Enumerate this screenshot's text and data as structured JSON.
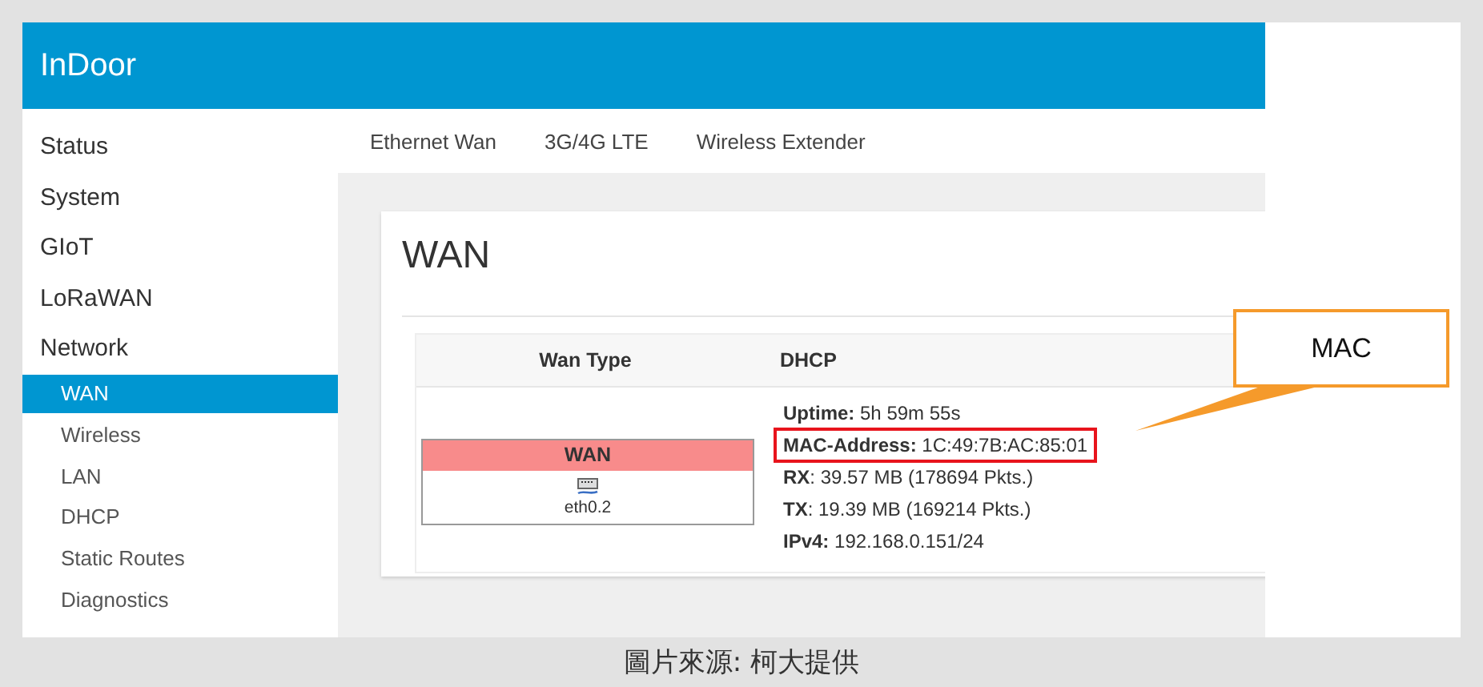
{
  "app": {
    "title": "InDoor"
  },
  "sidebar": {
    "items": [
      {
        "label": "Status",
        "selected": false
      },
      {
        "label": "System",
        "selected": false
      },
      {
        "label": "GIoT",
        "selected": false
      },
      {
        "label": "LoRaWAN",
        "selected": false
      },
      {
        "label": "Network",
        "selected": false,
        "children": [
          {
            "label": "WAN",
            "selected": true
          },
          {
            "label": "Wireless",
            "selected": false
          },
          {
            "label": "LAN",
            "selected": false
          },
          {
            "label": "DHCP",
            "selected": false
          },
          {
            "label": "Static Routes",
            "selected": false
          },
          {
            "label": "Diagnostics",
            "selected": false
          }
        ]
      }
    ]
  },
  "tabs": [
    {
      "label": "Ethernet Wan"
    },
    {
      "label": "3G/4G LTE"
    },
    {
      "label": "Wireless Extender"
    }
  ],
  "page": {
    "title": "WAN",
    "table": {
      "columns": [
        "Wan Type",
        "DHCP"
      ],
      "interface": {
        "name": "WAN",
        "device": "eth0.2",
        "color": "#f88b8b"
      },
      "details": [
        {
          "text": "**Uptime:** 5h 59m 55s",
          "highlighted": false
        },
        {
          "text": "**MAC-Address:** 1C:49:7B:AC:85:01",
          "highlighted": true
        },
        {
          "text": "**RX**: 39.57 MB (178694 Pkts.)",
          "highlighted": false
        },
        {
          "text": "**TX**: 19.39 MB (169214 Pkts.)",
          "highlighted": false
        },
        {
          "text": "**IPv4:** 192.168.0.151/24",
          "highlighted": false
        }
      ]
    }
  },
  "annotation": {
    "text": "MAC"
  },
  "caption": "圖片來源: 柯大提供"
}
